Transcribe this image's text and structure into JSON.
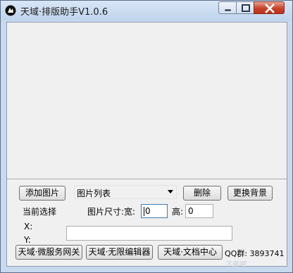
{
  "window": {
    "title": "天域·排版助手V1.0.6"
  },
  "toolbar": {
    "add_image": "添加图片",
    "image_list_selected": "图片列表",
    "delete": "删除",
    "replace_background": "更换背景"
  },
  "selection": {
    "current_label": "当前选择",
    "size_label": "图片尺寸:宽:",
    "width_value": "0",
    "height_label": "高:",
    "height_value": "0",
    "x_label": "X:",
    "y_label": "Y:",
    "y_value": ""
  },
  "links": {
    "gateway": "天域·微服务网关",
    "editor": "天域·无限编辑器",
    "docs": "天域·文档中心"
  },
  "status": {
    "qq": "QQ群: 3893741"
  },
  "watermark": "下载吧"
}
